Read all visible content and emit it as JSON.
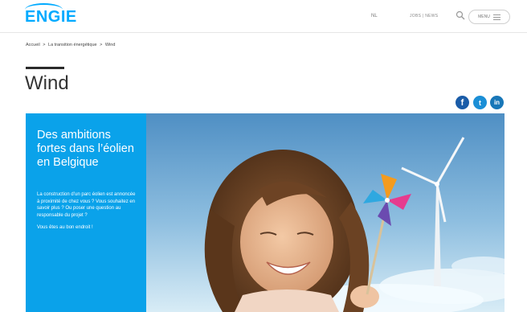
{
  "header": {
    "logo": "ENGIE",
    "lang": "NL",
    "links": "JOBS | NEWS",
    "menu_label": "MENU"
  },
  "breadcrumb": {
    "home": "Accueil",
    "sep1": ">",
    "level1": "La transition énergétique",
    "sep2": ">",
    "current": "Wind"
  },
  "page": {
    "title": "Wind"
  },
  "social": {
    "facebook": "f",
    "twitter": "t",
    "linkedin": "in"
  },
  "hero": {
    "heading": "Des ambitions fortes dans l’éolien en Belgique",
    "paragraph": "La construction d’un parc éolien est annoncée à proximité de chez vous ? Vous souhaitez en savoir plus ? Ou poser une question au responsable du projet ?",
    "closing": "Vous êtes au bon endroit !"
  },
  "colors": {
    "brand": "#00aaff",
    "panel": "#0aa2ea"
  }
}
